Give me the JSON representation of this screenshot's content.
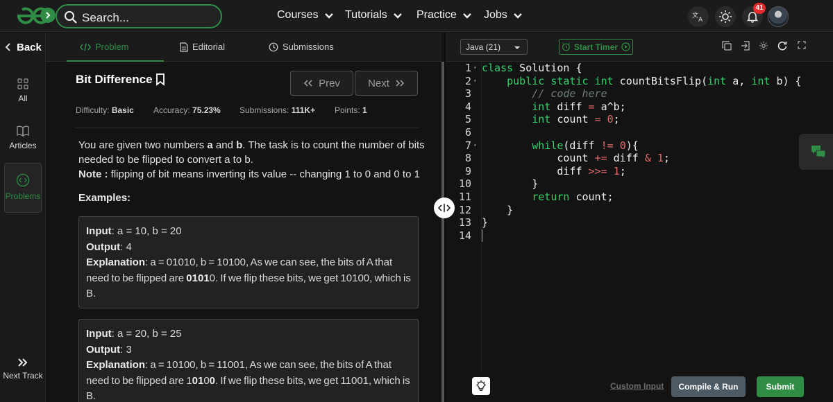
{
  "nav": {
    "search_placeholder": "Search...",
    "menu": [
      "Courses",
      "Tutorials",
      "Practice",
      "Jobs"
    ],
    "notifications_count": "41"
  },
  "rail": {
    "back_label": "Back",
    "items": [
      "All",
      "Articles",
      "Problems"
    ],
    "next_track": "Next Track"
  },
  "tabs": [
    "Problem",
    "Editorial",
    "Submissions"
  ],
  "problem": {
    "title": "Bit Difference",
    "prev_label": "Prev",
    "next_label": "Next",
    "meta": {
      "difficulty_label": "Difficulty:",
      "difficulty": "Basic",
      "accuracy_label": "Accuracy:",
      "accuracy": "75.23%",
      "submissions_label": "Submissions:",
      "submissions": "111K+",
      "points_label": "Points:",
      "points": "1"
    },
    "desc_1": "You are given two numbers ",
    "desc_a": "a",
    "desc_and": " and ",
    "desc_b": "b",
    "desc_2": ". The task is to count the number of bits needed to be flipped to convert a to b.",
    "note_label": "Note :",
    "note_text": " flipping of bit means inverting its value -- changing 1 to 0 and 0 to 1",
    "examples_label": "Examples:",
    "examples": [
      {
        "input_label": "Input",
        "input": ":  a  =  10,  b  =  20",
        "output_label": "Output",
        "output": ":  4",
        "explanation_label": "Explanation",
        "explanation_1": ":  a   =  01010,  b   =  10100,  As  we  can  see,  the  bits  of  A  that  need  to  be  flipped  are  ",
        "explanation_bold": "0101",
        "explanation_2": "0.  If  we  flip  these  bits,  we  get  10100,  which  is  B."
      },
      {
        "input_label": "Input",
        "input": ":  a  =  20,  b  =  25",
        "output_label": "Output",
        "output": ":  3",
        "explanation_label": "Explanation",
        "explanation_1": ":  a   =  10100,  b   =  11001,  As  we  can  see,  the  bits  of  A  that  need  to  be  flipped  are  1",
        "explanation_bold": "01",
        "explanation_2": "0",
        "explanation_bold_2": "0",
        "explanation_3": ".  If  we  flip  these  bits,  we  get  11001,  which  is  B."
      }
    ]
  },
  "editor": {
    "language": "Java (21)",
    "timer_label": "Start Timer",
    "line_numbers": [
      "1",
      "2",
      "3",
      "4",
      "5",
      "6",
      "7",
      "8",
      "9",
      "10",
      "11",
      "12",
      "13",
      "14"
    ],
    "custom_input_label": "Custom Input",
    "compile_label": "Compile & Run",
    "submit_label": "Submit",
    "code": {
      "l1_kw": "class",
      "l1_rest": " Solution {",
      "l2_kw1": "public",
      "l2_kw2": "static",
      "l2_kw3": "int",
      "l2_rest1": " countBitsFlip(",
      "l2_kw4": "int",
      "l2_rest2": " a, ",
      "l2_kw5": "int",
      "l2_rest3": " b) {",
      "l3_comment": "// code here",
      "l4_kw": "int",
      "l4_rest1": " diff ",
      "l4_op": "=",
      "l4_rest2": " a^b;",
      "l5_kw": "int",
      "l5_rest1": " count ",
      "l5_op": "=",
      "l5_num": "0",
      "l5_rest2": ";",
      "l7_kw": "while",
      "l7_rest1": "(diff ",
      "l7_op": "!=",
      "l7_num": "0",
      "l7_rest2": "){",
      "l8_rest1": "count ",
      "l8_op1": "+=",
      "l8_rest2": " diff ",
      "l8_op2": "&",
      "l8_num": "1",
      "l8_rest3": ";",
      "l9_rest1": "diff ",
      "l9_op": ">>=",
      "l9_num": "1",
      "l9_rest2": ";",
      "l10": "}",
      "l11_kw": "return",
      "l11_rest": " count;",
      "l12": "}",
      "l13": "}"
    }
  }
}
